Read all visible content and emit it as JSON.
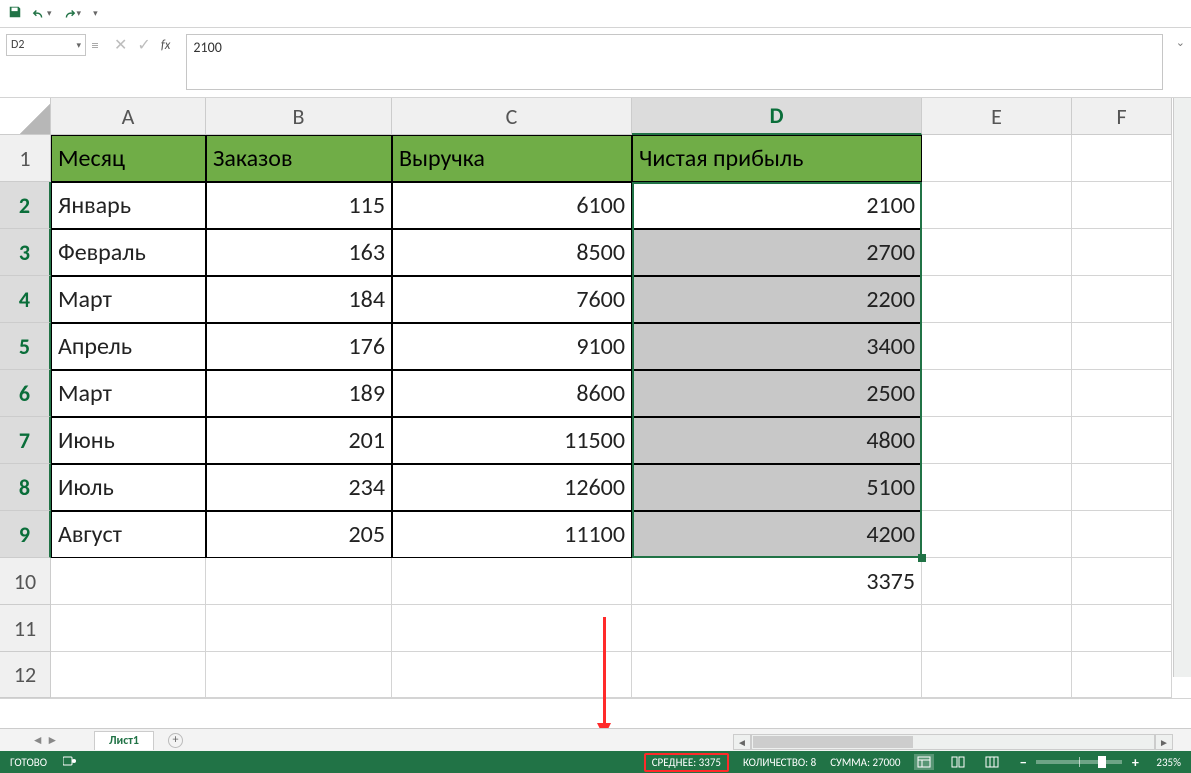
{
  "qat": {
    "save": "save",
    "undo": "undo",
    "redo": "redo"
  },
  "namebox": {
    "value": "D2"
  },
  "formula": {
    "value": "2100"
  },
  "columns": [
    "A",
    "B",
    "C",
    "D",
    "E",
    "F"
  ],
  "row_numbers": [
    1,
    2,
    3,
    4,
    5,
    6,
    7,
    8,
    9,
    10,
    11,
    12
  ],
  "headers": {
    "a": "Месяц",
    "b": "Заказов",
    "c": "Выручка",
    "d": "Чистая прибыль"
  },
  "rows": [
    {
      "a": "Январь",
      "b": "115",
      "c": "6100",
      "d": "2100"
    },
    {
      "a": "Февраль",
      "b": "163",
      "c": "8500",
      "d": "2700"
    },
    {
      "a": "Март",
      "b": "184",
      "c": "7600",
      "d": "2200"
    },
    {
      "a": "Апрель",
      "b": "176",
      "c": "9100",
      "d": "3400"
    },
    {
      "a": "Март",
      "b": "189",
      "c": "8600",
      "d": "2500"
    },
    {
      "a": "Июнь",
      "b": "201",
      "c": "11500",
      "d": "4800"
    },
    {
      "a": "Июль",
      "b": "234",
      "c": "12600",
      "d": "5100"
    },
    {
      "a": "Август",
      "b": "205",
      "c": "11100",
      "d": "4200"
    }
  ],
  "d10": "3375",
  "sheet": {
    "name": "Лист1"
  },
  "status": {
    "ready": "ГОТОВО",
    "avg": "СРЕДНЕЕ: 3375",
    "count": "КОЛИЧЕСТВО: 8",
    "sum": "СУММА: 27000",
    "zoom": "235%"
  }
}
